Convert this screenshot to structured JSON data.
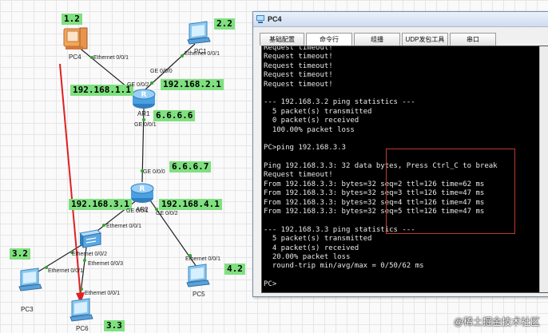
{
  "topology": {
    "devices": {
      "pc4": {
        "name": "PC4"
      },
      "pc1": {
        "name": "PC1"
      },
      "ar1": {
        "name": "AR1"
      },
      "ar2": {
        "name": "AR2"
      },
      "pc3": {
        "name": "PC3"
      },
      "pc5": {
        "name": "PC5"
      },
      "pc6": {
        "name": "PC6"
      }
    },
    "ip_labels": {
      "pc4_tag": "1.2",
      "pc1_tag": "2.2",
      "ar1_g002": "192.168.1.1",
      "ar1_g000": "192.168.2.1",
      "ar1_link": "6.6.6.6",
      "ar2_link": "6.6.6.7",
      "ar2_left": "192.168.3.1",
      "ar2_right": "192.168.4.1",
      "pc3_tag": "3.2",
      "pc5_tag": "4.2",
      "pc6_tag": "3.3"
    },
    "ports": {
      "pc4_eth": "Ethernet 0/0/1",
      "pc1_eth": "Ethernet 0/0/1",
      "ar1_ge000": "GE 0/0/0",
      "ar1_ge002": "GE 0/0/2",
      "ar1_ge001": "GE 0/0/1",
      "ar2_ge000": "GE 0/0/0",
      "ar2_ge001": "GE 0/0/1",
      "ar2_ge002": "GE 0/0/2",
      "sw_eth001": "Ethernet 0/0/1",
      "sw_eth002": "Ethernet 0/0/2",
      "sw_eth003": "Ethernet 0/0/3",
      "pc3_eth": "Ethernet 0/0/1",
      "pc5_eth": "Ethernet 0/0/1",
      "pc6_eth": "Ethernet 0/0/1"
    }
  },
  "window": {
    "title": "PC4",
    "tabs": [
      "基础配置",
      "命令行",
      "组播",
      "UDP发包工具",
      "串口"
    ],
    "active_tab": 1,
    "console_lines": [
      "Request timeout!",
      "Request timeout!",
      "Request timeout!",
      "Request timeout!",
      "Request timeout!",
      "",
      "--- 192.168.3.2 ping statistics ---",
      "  5 packet(s) transmitted",
      "  0 packet(s) received",
      "  100.00% packet loss",
      "",
      "PC>ping 192.168.3.3",
      "",
      "Ping 192.168.3.3: 32 data bytes, Press Ctrl_C to break",
      "Request timeout!",
      "From 192.168.3.3: bytes=32 seq=2 ttl=126 time=62 ms",
      "From 192.168.3.3: bytes=32 seq=3 ttl=126 time=47 ms",
      "From 192.168.3.3: bytes=32 seq=4 ttl=126 time=47 ms",
      "From 192.168.3.3: bytes=32 seq=5 ttl=126 time=47 ms",
      "",
      "--- 192.168.3.3 ping statistics ---",
      "  5 packet(s) transmitted",
      "  4 packet(s) received",
      "  20.00% packet loss",
      "  round-trip min/avg/max = 0/50/62 ms",
      "",
      "PC>"
    ]
  },
  "watermark": "@稀土掘金技术社区",
  "colors": {
    "ip_label_bg": "#7fe07f",
    "annotation_red": "#e02020",
    "console_bg": "#000000"
  }
}
